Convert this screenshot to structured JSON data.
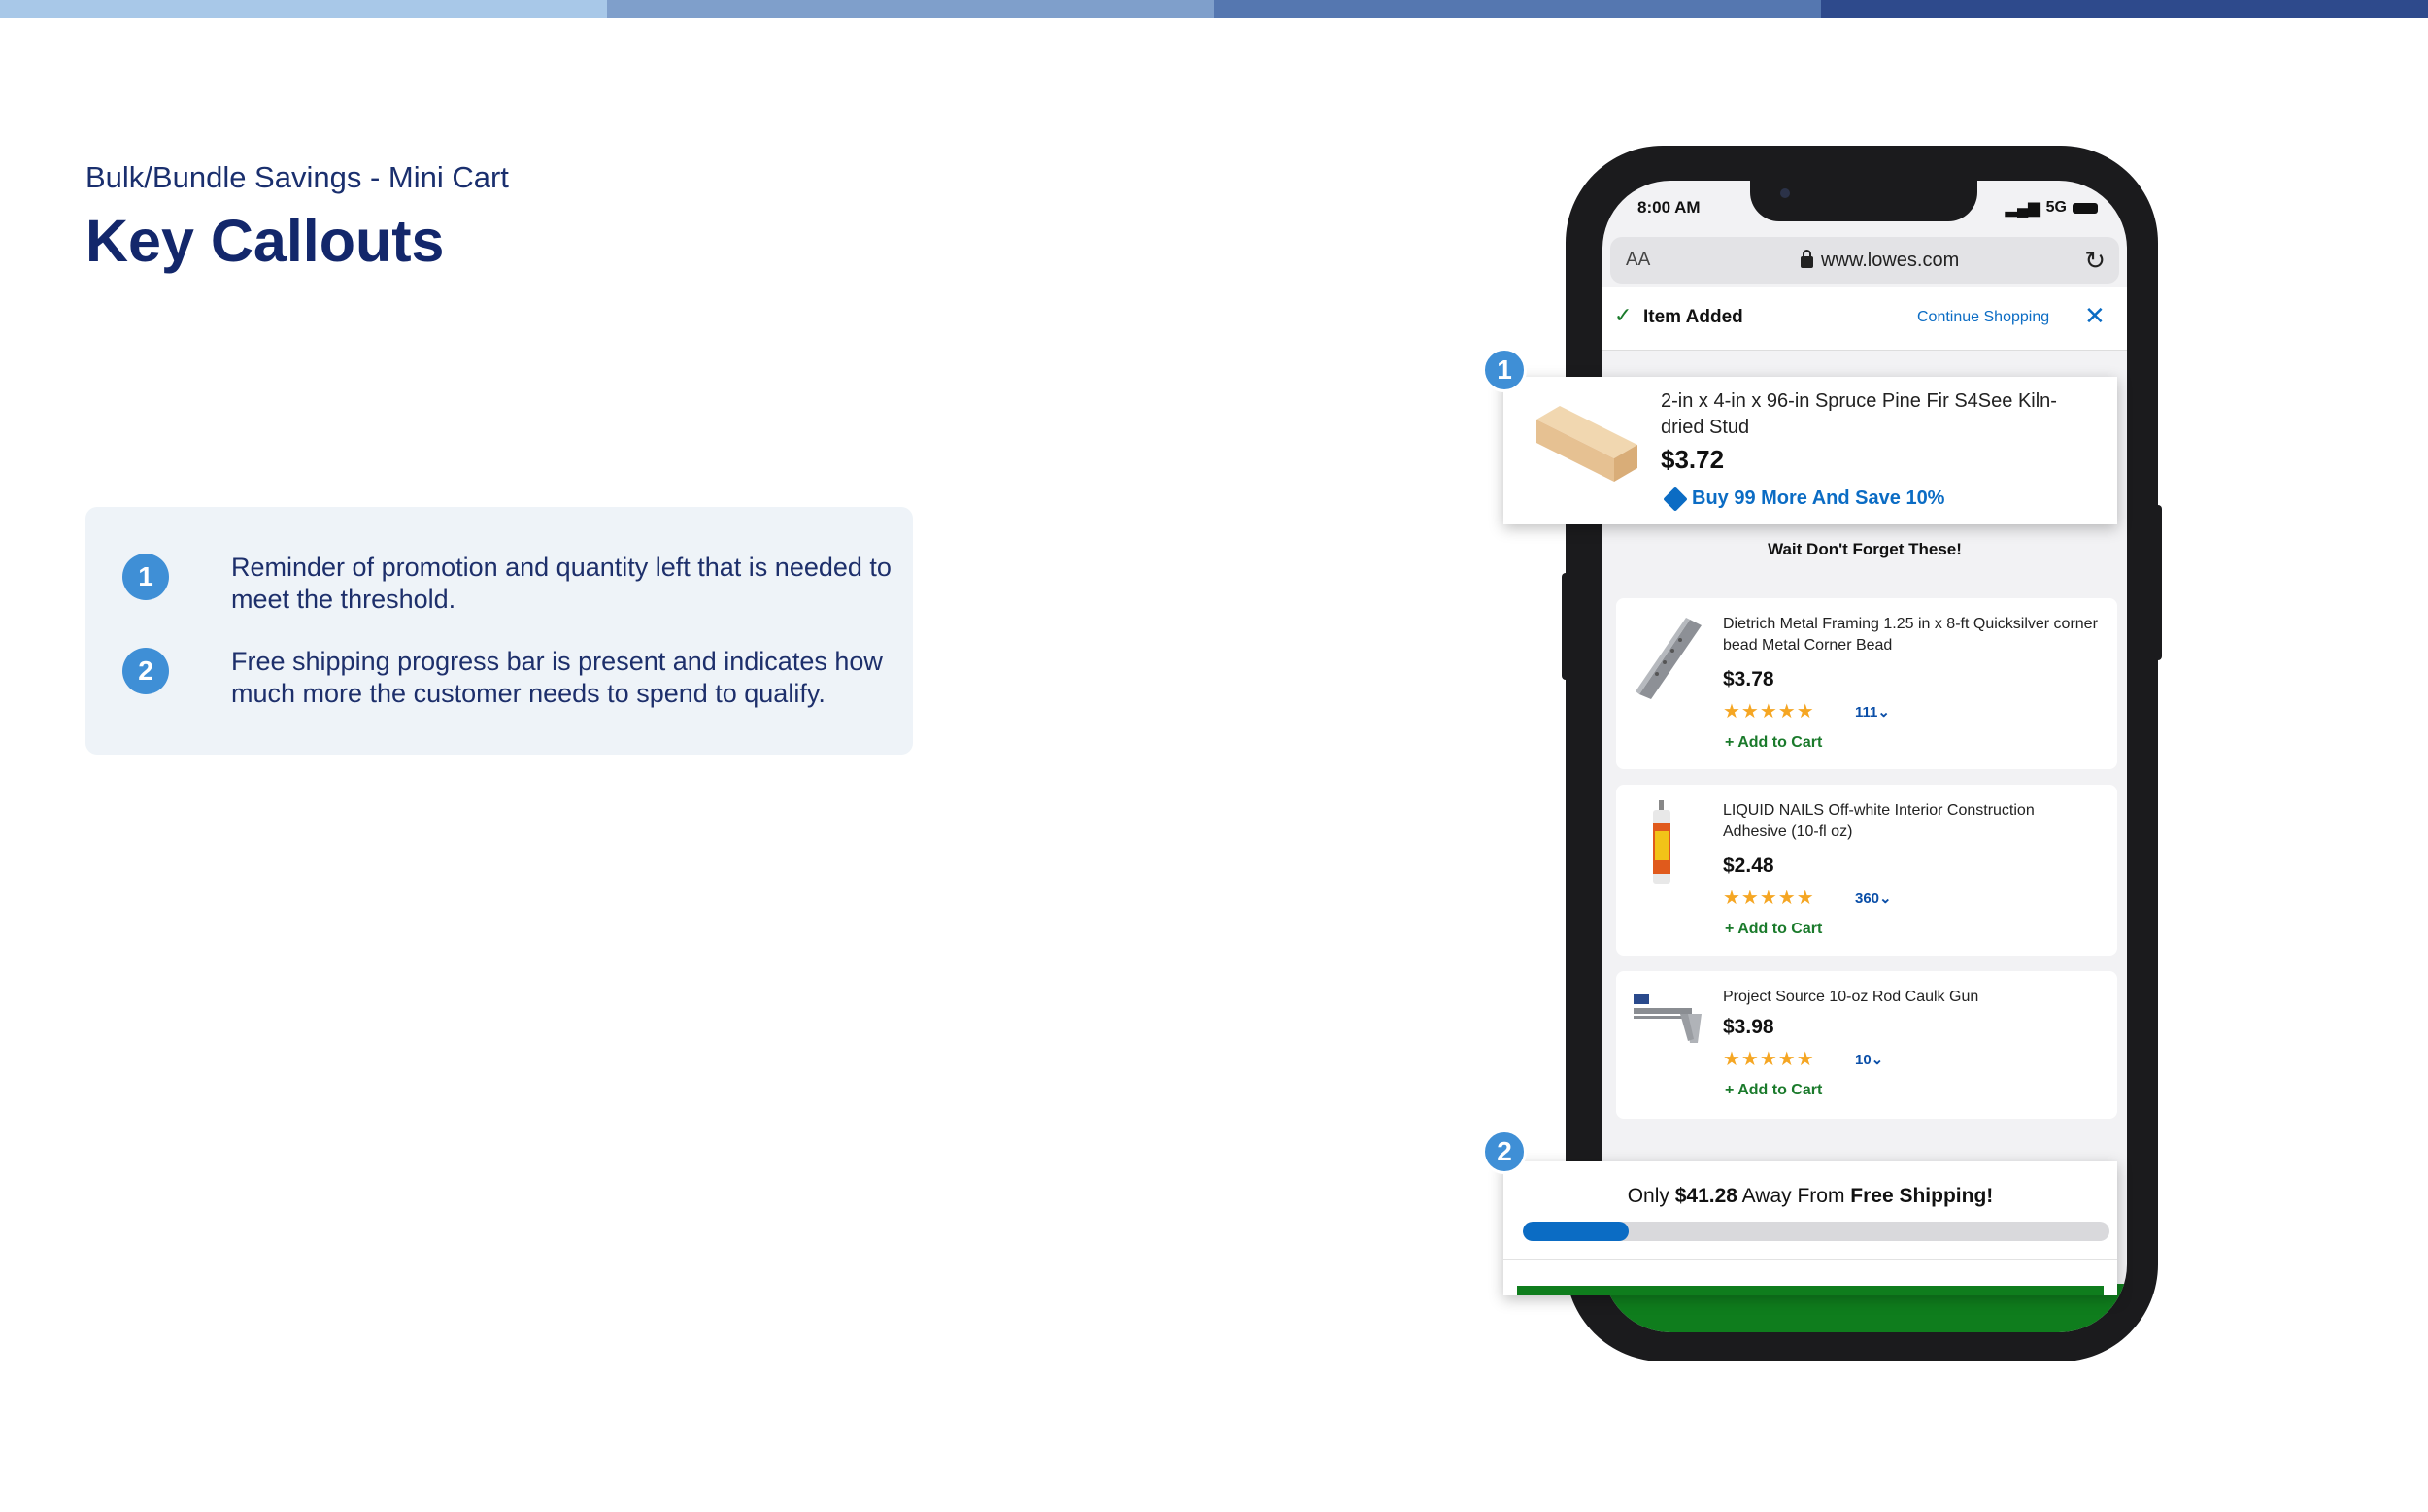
{
  "header": {
    "subtitle": "Bulk/Bundle Savings - Mini Cart",
    "title": "Key Callouts",
    "band_colors": [
      "#a8c8e8",
      "#7f9fcb",
      "#5577b0",
      "#2e4a8c"
    ]
  },
  "callouts": [
    {
      "num": "1",
      "text": "Reminder of promotion and quantity left that is needed to meet the threshold."
    },
    {
      "num": "2",
      "text": "Free shipping progress bar is present and indicates how much more the customer needs to spend to qualify."
    }
  ],
  "phone": {
    "time": "8:00 AM",
    "network": "5G",
    "aa": "AA",
    "url": "www.lowes.com",
    "reload_icon": "↻",
    "item_added": {
      "check_icon": "✓",
      "label": "Item Added",
      "continue": "Continue Shopping",
      "close_icon": "✕"
    },
    "product": {
      "name": "2-in x 4-in x 96-in Spruce Pine Fir S4See Kiln-dried Stud",
      "price": "$3.72",
      "promo": "Buy 99 More And Save 10%"
    },
    "wait_text": "Wait Don't Forget These!",
    "recommendations": [
      {
        "name": "Dietrich Metal Framing 1.25 in x 8-ft Quicksilver corner bead Metal Corner Bead",
        "price": "$3.78",
        "stars": "★★★★★",
        "rating_count": "111⌄",
        "add": "+ Add to Cart"
      },
      {
        "name": "LIQUID NAILS Off-white Interior Construction Adhesive (10-fl oz)",
        "price": "$2.48",
        "stars": "★★★★★",
        "rating_count": "360⌄",
        "add": "+ Add to Cart"
      },
      {
        "name": "Project Source 10-oz Rod Caulk Gun",
        "price": "$3.98",
        "stars": "★★★★★",
        "rating_count": "10⌄",
        "add": "+ Add to Cart"
      }
    ],
    "shipping": {
      "prefix": "Only ",
      "amount": "$41.28",
      "middle": " Away From ",
      "bold_end": "Free Shipping!",
      "progress_fraction": 0.18
    }
  },
  "badges": [
    "1",
    "2"
  ],
  "colors": {
    "accent": "#3f8fd6",
    "link": "#0b6cc4",
    "green": "#0f7d1d"
  }
}
